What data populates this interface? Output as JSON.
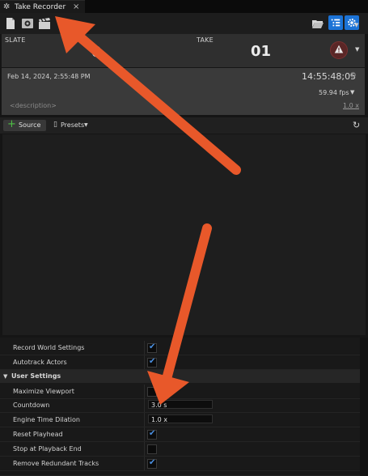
{
  "tab": {
    "title": "Take Recorder",
    "close": "×"
  },
  "slate": {
    "label": "SLATE",
    "value": "0"
  },
  "take": {
    "label": "TAKE",
    "value": "01"
  },
  "info": {
    "date": "Feb 14, 2024, 2:55:48 PM",
    "timecode": "14:55:48;05",
    "fps": "59.94 fps",
    "description_placeholder": "<description>",
    "speed": "1.0 x"
  },
  "sources": {
    "add_label": "Source",
    "presets_label": "Presets"
  },
  "settings": {
    "rows_top": [
      {
        "label": "Record World Settings",
        "checked": true
      },
      {
        "label": "Autotrack Actors",
        "checked": true
      }
    ],
    "user_section": "User Settings",
    "rows_user": [
      {
        "label": "Maximize Viewport",
        "type": "check",
        "checked": false
      },
      {
        "label": "Countdown",
        "type": "text",
        "value": "3.0 s"
      },
      {
        "label": "Engine Time Dilation",
        "type": "text",
        "value": "1.0 x"
      },
      {
        "label": "Reset Playhead",
        "type": "check",
        "checked": true
      },
      {
        "label": "Stop at Playback End",
        "type": "check",
        "checked": false
      },
      {
        "label": "Remove Redundant Tracks",
        "type": "check",
        "checked": true
      }
    ]
  },
  "colors": {
    "annotation_arrow": "#e8582a",
    "accent_blue": "#1c73d6"
  }
}
